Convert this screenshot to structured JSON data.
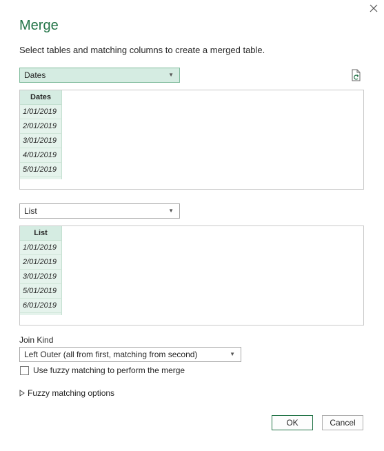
{
  "dialog": {
    "title": "Merge",
    "subtitle": "Select tables and matching columns to create a merged table."
  },
  "first_table": {
    "selected": "Dates",
    "column_header": "Dates",
    "rows": [
      "1/01/2019",
      "2/01/2019",
      "3/01/2019",
      "4/01/2019",
      "5/01/2019"
    ]
  },
  "second_table": {
    "selected": "List",
    "column_header": "List",
    "rows": [
      "1/01/2019",
      "2/01/2019",
      "3/01/2019",
      "5/01/2019",
      "6/01/2019"
    ]
  },
  "join": {
    "label": "Join Kind",
    "selected": "Left Outer (all from first, matching from second)"
  },
  "fuzzy": {
    "checkbox_label": "Use fuzzy matching to perform the merge",
    "checked": false,
    "options_label": "Fuzzy matching options"
  },
  "buttons": {
    "ok": "OK",
    "cancel": "Cancel"
  },
  "colors": {
    "accent": "#217346",
    "column_bg": "#e5f3ec",
    "header_bg": "#d5ece2"
  },
  "icons": {
    "close": "close-icon",
    "refresh": "refresh-icon",
    "dropdown": "chevron-down-icon",
    "expand": "expand-triangle-icon"
  }
}
